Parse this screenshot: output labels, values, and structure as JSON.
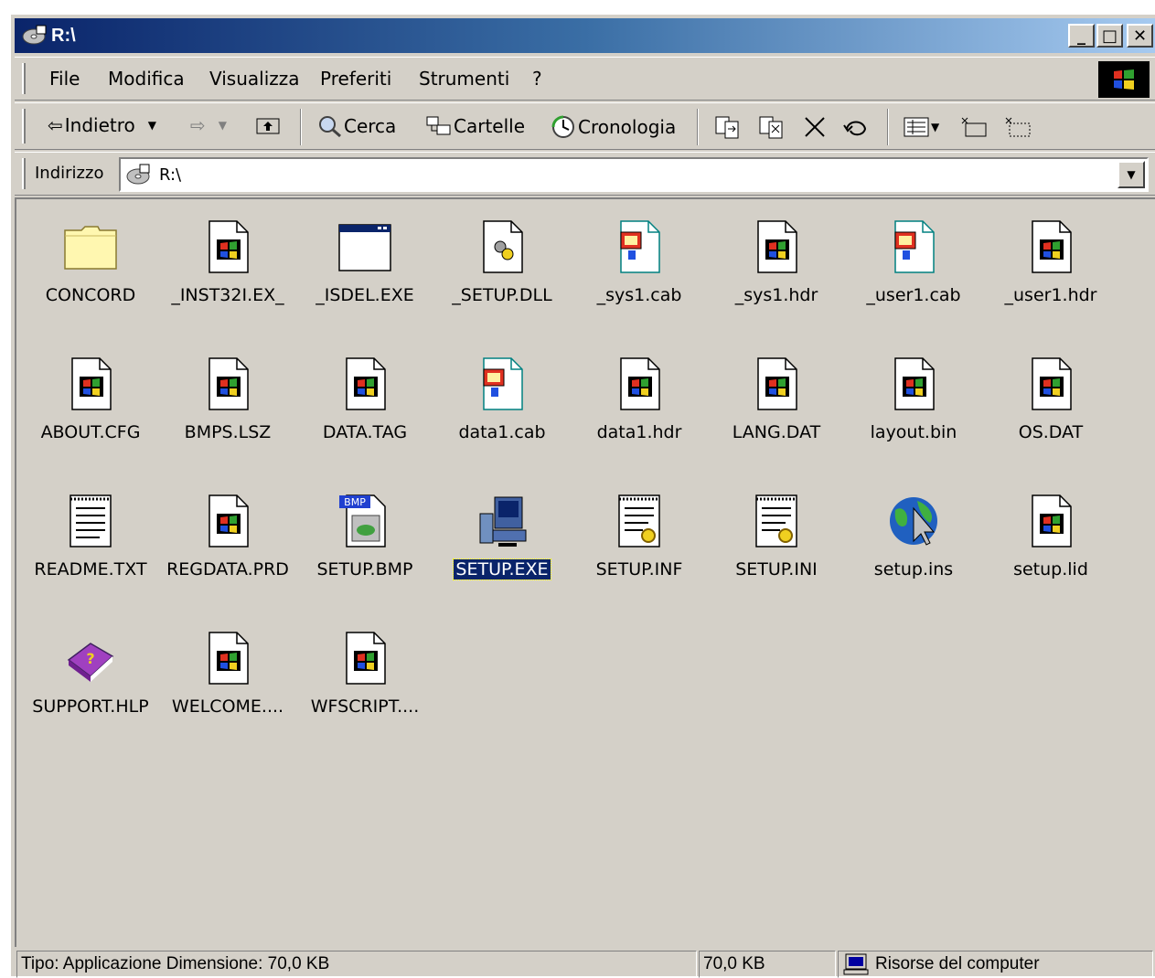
{
  "window": {
    "title": "R:\\"
  },
  "title_buttons": {
    "minimize": "_",
    "maximize": "□",
    "close": "✕"
  },
  "menu": [
    "File",
    "Modifica",
    "Visualizza",
    "Preferiti",
    "Strumenti",
    "?"
  ],
  "toolbar": {
    "back": "Indietro",
    "search": "Cerca",
    "folders": "Cartelle",
    "history": "Cronologia"
  },
  "address": {
    "label": "Indirizzo",
    "value": "R:\\"
  },
  "files": [
    {
      "name": "CONCORD",
      "icon": "folder-icon"
    },
    {
      "name": "_INST32I.EX_",
      "icon": "windows-file-icon"
    },
    {
      "name": "_ISDEL.EXE",
      "icon": "program-window-icon"
    },
    {
      "name": "_SETUP.DLL",
      "icon": "dll-file-icon"
    },
    {
      "name": "_sys1.cab",
      "icon": "cab-file-icon"
    },
    {
      "name": "_sys1.hdr",
      "icon": "windows-file-icon"
    },
    {
      "name": "_user1.cab",
      "icon": "cab-file-icon"
    },
    {
      "name": "_user1.hdr",
      "icon": "windows-file-icon"
    },
    {
      "name": "ABOUT.CFG",
      "icon": "windows-file-icon"
    },
    {
      "name": "BMPS.LSZ",
      "icon": "windows-file-icon"
    },
    {
      "name": "DATA.TAG",
      "icon": "windows-file-icon"
    },
    {
      "name": "data1.cab",
      "icon": "cab-file-icon"
    },
    {
      "name": "data1.hdr",
      "icon": "windows-file-icon"
    },
    {
      "name": "LANG.DAT",
      "icon": "windows-file-icon"
    },
    {
      "name": "layout.bin",
      "icon": "windows-file-icon"
    },
    {
      "name": "OS.DAT",
      "icon": "windows-file-icon"
    },
    {
      "name": "README.TXT",
      "icon": "text-file-icon"
    },
    {
      "name": "REGDATA.PRD",
      "icon": "windows-file-icon"
    },
    {
      "name": "SETUP.BMP",
      "icon": "bitmap-file-icon"
    },
    {
      "name": "SETUP.EXE",
      "icon": "setup-computer-icon",
      "selected": true
    },
    {
      "name": "SETUP.INF",
      "icon": "settings-file-icon"
    },
    {
      "name": "SETUP.INI",
      "icon": "settings-file-icon"
    },
    {
      "name": "setup.ins",
      "icon": "globe-cursor-icon"
    },
    {
      "name": "setup.lid",
      "icon": "windows-file-icon"
    },
    {
      "name": "SUPPORT.HLP",
      "icon": "help-book-icon"
    },
    {
      "name": "WELCOME....",
      "icon": "windows-file-icon"
    },
    {
      "name": "WFSCRIPT....",
      "icon": "windows-file-icon"
    }
  ],
  "status": {
    "info": "Tipo: Applicazione Dimensione: 70,0 KB",
    "size": "70,0 KB",
    "location": "Risorse del computer"
  }
}
